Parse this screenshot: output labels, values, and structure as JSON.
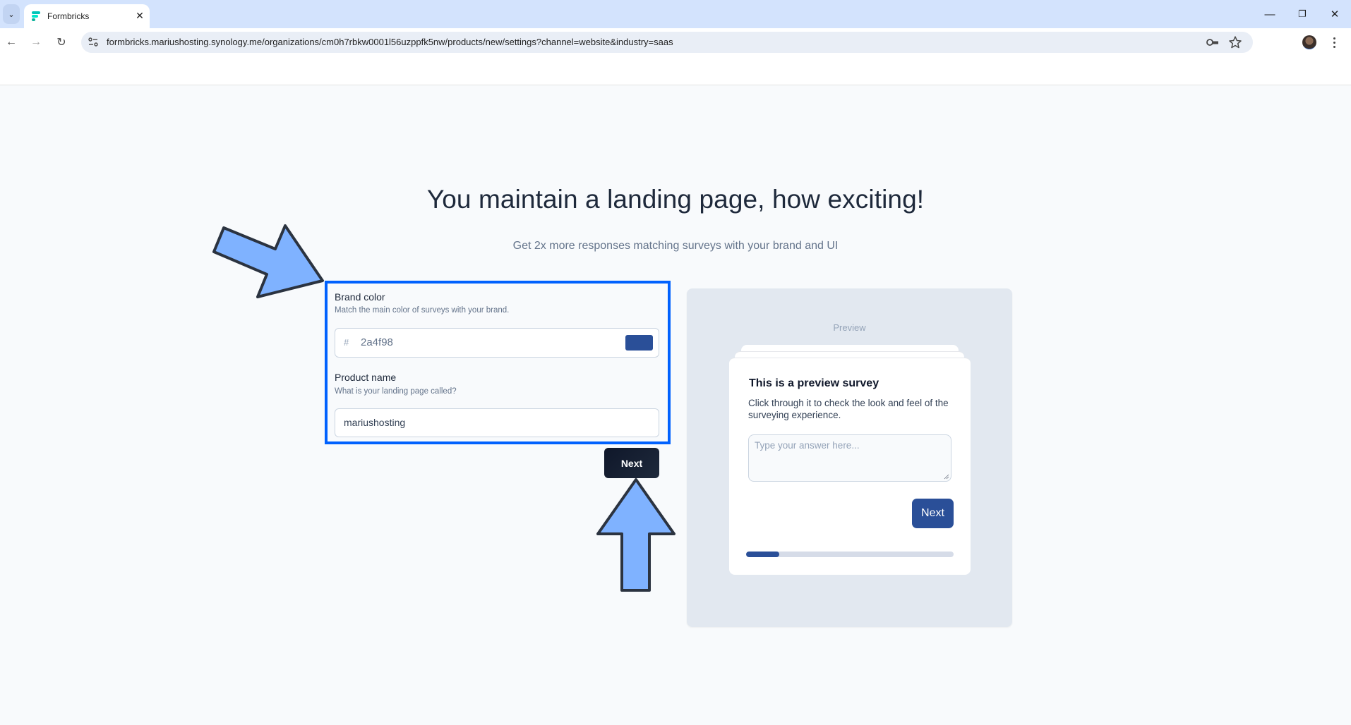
{
  "browser": {
    "tab": {
      "title": "Formbricks",
      "close_icon": "close-icon"
    },
    "url": "formbricks.mariushosting.synology.me/organizations/cm0h7rbkw0001l56uzppfk5nw/products/new/settings?channel=website&industry=saas",
    "window_controls": {
      "minimize": "—",
      "restore": "❐",
      "close": "✕"
    },
    "nav": {
      "back": "←",
      "forward": "→",
      "reload": "↻"
    }
  },
  "main": {
    "title": "You maintain a landing page, how exciting!",
    "subtitle": "Get 2x more responses matching surveys with your brand and UI",
    "brand_color": {
      "label": "Brand color",
      "hint": "Match the main color of surveys with your brand.",
      "prefix": "#",
      "value": "2a4f98",
      "swatch_color": "#2a4f98"
    },
    "product_name": {
      "label": "Product name",
      "hint": "What is your landing page called?",
      "value": "mariushosting"
    },
    "next_label": "Next"
  },
  "preview": {
    "label": "Preview",
    "survey_title": "This is a preview survey",
    "survey_description": "Click through it to check the look and feel of the surveying experience.",
    "answer_placeholder": "Type your answer here...",
    "next_label": "Next",
    "progress_percent": 16,
    "brand_color": "#2a4f98"
  },
  "annotations": {
    "highlight_color": "#0061fe",
    "arrow_fill": "#7fb2ff",
    "arrow_stroke": "#2b3340"
  }
}
